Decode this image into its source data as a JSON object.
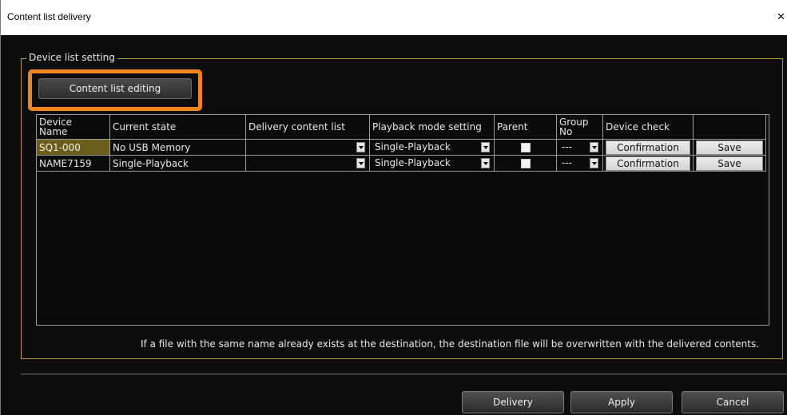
{
  "window": {
    "title": "Content list delivery",
    "close_glyph": "×"
  },
  "group": {
    "label": "Device list setting",
    "content_list_editing_button": "Content list editing"
  },
  "table": {
    "headers": [
      "Device Name",
      "Current state",
      "Delivery content list",
      "Playback mode setting",
      "Parent",
      "Group No",
      "Device check",
      ""
    ],
    "rows": [
      {
        "device_name": "SQ1-000",
        "selected": true,
        "current_state": "No USB Memory",
        "delivery_content_list": "",
        "playback_mode": "Single-Playback",
        "parent_checked": false,
        "group_no": "---",
        "device_check": "Confirmation",
        "save": "Save"
      },
      {
        "device_name": "NAME7159",
        "selected": false,
        "current_state": "Single-Playback",
        "delivery_content_list": "",
        "playback_mode": "Single-Playback",
        "parent_checked": false,
        "group_no": "---",
        "device_check": "Confirmation",
        "save": "Save"
      }
    ]
  },
  "notice": "If a file with the same name already exists at the destination, the destination file will be overwritten with the delivered contents.",
  "buttons": {
    "delivery": "Delivery",
    "apply": "Apply",
    "cancel": "Cancel"
  },
  "colors": {
    "background": "#0d0d0d",
    "group_border": "#b59a2a",
    "highlight": "#f0841f",
    "selected_cell": "#6b5e1d"
  }
}
